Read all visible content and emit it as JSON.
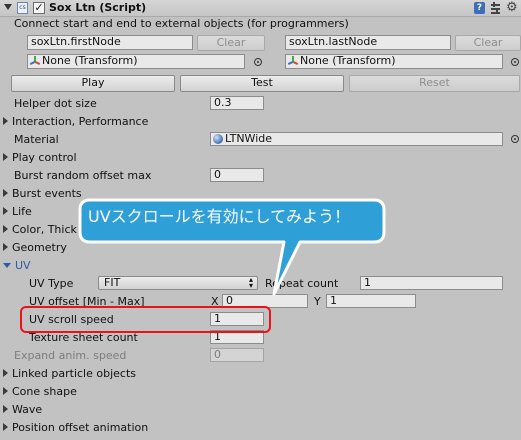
{
  "header": {
    "title": "Sox Ltn (Script)",
    "enabled": true,
    "description": "Connect start and end to external objects (for programmers)"
  },
  "nodes": {
    "first_placeholder": "soxLtn.firstNode",
    "last_placeholder": "soxLtn.lastNode",
    "clear_label": "Clear",
    "first_object": "None (Transform)",
    "last_object": "None (Transform)"
  },
  "actions": {
    "play": "Play",
    "test": "Test",
    "reset": "Reset"
  },
  "fields": {
    "helper_dot_size": {
      "label": "Helper dot size",
      "value": "0.3"
    },
    "interaction": "Interaction, Performance",
    "material": {
      "label": "Material",
      "value": "LTNWide"
    },
    "play_control": "Play control",
    "burst_random": {
      "label": "Burst random offset max",
      "value": "0"
    },
    "burst_events": "Burst events",
    "life": "Life",
    "color_thick": "Color, Thick",
    "geometry": "Geometry",
    "uv": "UV",
    "uv_type": {
      "label": "UV Type",
      "value": "FIT"
    },
    "repeat_count": {
      "label": "Repeat count",
      "value": "1"
    },
    "uv_offset": {
      "label": "UV offset [Min - Max]",
      "x_label": "X",
      "x": "0",
      "y_label": "Y",
      "y": "1"
    },
    "uv_scroll_speed": {
      "label": "UV scroll speed",
      "value": "1"
    },
    "texture_sheet_count": {
      "label": "Texture sheet count",
      "value": "1"
    },
    "expand_anim_speed": {
      "label": "Expand anim. speed",
      "value": "0"
    },
    "linked": "Linked particle objects",
    "cone_shape": "Cone shape",
    "wave": "Wave",
    "position_offset": "Position offset animation"
  },
  "callout": {
    "text": "UVスクロールを有効にしてみよう！"
  },
  "colors": {
    "highlight": "#e8141b",
    "callout_bg": "#2f9fd8",
    "callout_border": "#ffffff"
  }
}
